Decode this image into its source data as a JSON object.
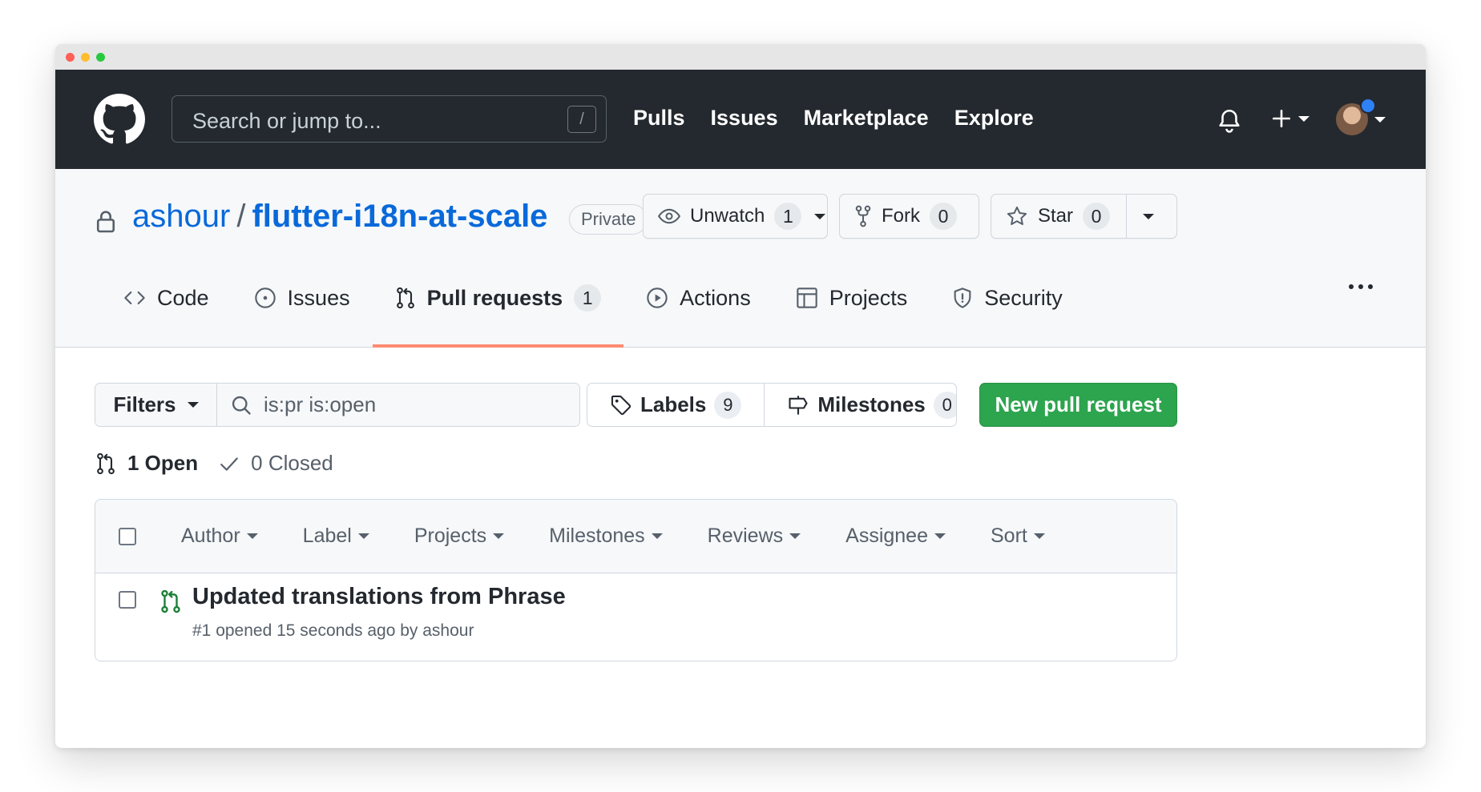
{
  "header": {
    "search_placeholder": "Search or jump to...",
    "search_shortcut": "/",
    "nav": [
      "Pulls",
      "Issues",
      "Marketplace",
      "Explore"
    ]
  },
  "repo": {
    "owner": "ashour",
    "separator": "/",
    "name": "flutter-i18n-at-scale",
    "visibility": "Private",
    "watch_label": "Unwatch",
    "watch_count": "1",
    "fork_label": "Fork",
    "fork_count": "0",
    "star_label": "Star",
    "star_count": "0"
  },
  "tabs": [
    {
      "label": "Code",
      "icon": "code-icon"
    },
    {
      "label": "Issues",
      "icon": "issue-opened-icon"
    },
    {
      "label": "Pull requests",
      "icon": "git-pull-request-icon",
      "count": "1",
      "selected": true
    },
    {
      "label": "Actions",
      "icon": "play-icon"
    },
    {
      "label": "Projects",
      "icon": "table-icon"
    },
    {
      "label": "Security",
      "icon": "shield-icon"
    }
  ],
  "toolbar": {
    "filters_label": "Filters",
    "query": "is:pr is:open",
    "labels_label": "Labels",
    "labels_count": "9",
    "milestones_label": "Milestones",
    "milestones_count": "0",
    "new_pr_label": "New pull request"
  },
  "states": {
    "open": "1 Open",
    "closed": "0 Closed"
  },
  "list_header": [
    "Author",
    "Label",
    "Projects",
    "Milestones",
    "Reviews",
    "Assignee",
    "Sort"
  ],
  "pull_requests": [
    {
      "title": "Updated translations from Phrase",
      "meta": "#1 opened 15 seconds ago by ashour"
    }
  ],
  "colors": {
    "header_bg": "#24292f",
    "link": "#0969da",
    "primary_button": "#2da44e",
    "selected_tab_underline": "#fd8c73",
    "open_pr_icon": "#1a7f37"
  }
}
